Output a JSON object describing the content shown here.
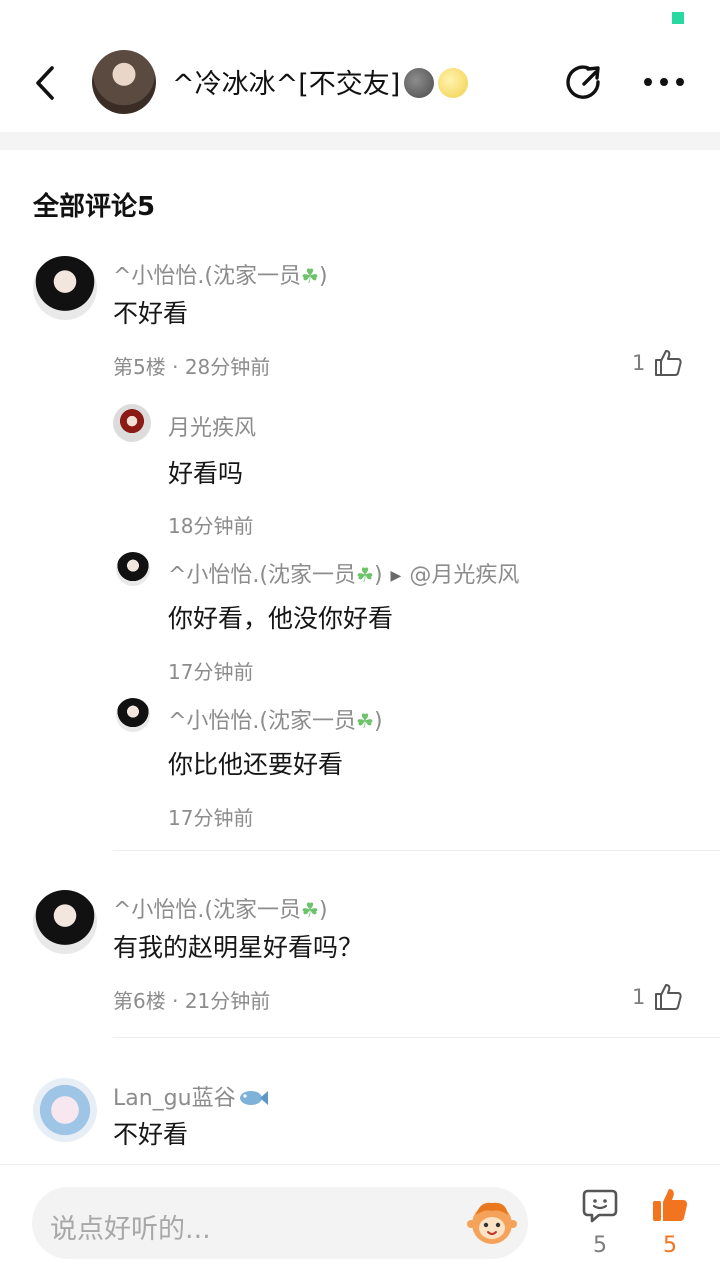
{
  "header": {
    "title": "^冷冰冰^[不交友]",
    "icons": [
      "back-icon",
      "share-icon",
      "more-icon"
    ]
  },
  "comments_section": {
    "title": "全部评论5"
  },
  "comments": [
    {
      "username": "^小怡怡.(沈家一员",
      "username_close": ")",
      "text": "不好看",
      "floor": "第5楼",
      "time": "28分钟前",
      "likes": "1",
      "replies": [
        {
          "username": "月光疾风",
          "text": "好看吗",
          "time": "18分钟前"
        },
        {
          "username": "^小怡怡.(沈家一员",
          "username_close": ")",
          "reply_to": "@月光疾风",
          "text": "你好看，他没你好看",
          "time": "17分钟前"
        },
        {
          "username": "^小怡怡.(沈家一员",
          "username_close": ")",
          "text": "你比他还要好看",
          "time": "17分钟前"
        }
      ]
    },
    {
      "username": "^小怡怡.(沈家一员",
      "username_close": ")",
      "text": "有我的赵明星好看吗？",
      "floor": "第6楼",
      "time": "21分钟前",
      "likes": "1"
    },
    {
      "username": "Lan_gu蓝谷",
      "text": "不好看"
    }
  ],
  "bottom_bar": {
    "input_placeholder": "说点好听的...",
    "comment_count": "5",
    "like_count": "5"
  },
  "colors": {
    "accent_orange": "#f2741e",
    "text_gray": "#8c8c8c",
    "status_green": "#27d8a1"
  }
}
